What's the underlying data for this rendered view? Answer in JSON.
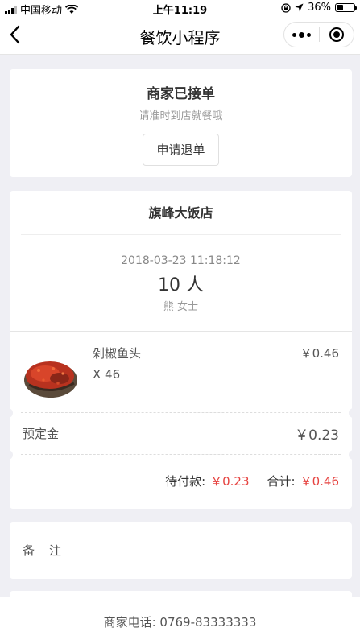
{
  "status_bar": {
    "carrier": "中国移动",
    "time": "上午11:19",
    "battery_percent": "36%",
    "battery_level": 0.36
  },
  "nav": {
    "title": "餐饮小程序"
  },
  "order_status": {
    "title": "商家已接单",
    "subtitle": "请准时到店就餐哦",
    "refund_label": "申请退单"
  },
  "order": {
    "store_name": "旗峰大饭店",
    "time": "2018-03-23 11:18:12",
    "people": "10 人",
    "customer": "熊 女士",
    "items": [
      {
        "name": "剁椒鱼头",
        "qty": "X 46",
        "price": "￥0.46"
      }
    ],
    "deposit_label": "预定金",
    "deposit_value": "￥0.23",
    "to_pay_label": "待付款:",
    "to_pay_value": "￥0.23",
    "total_label": "合计:",
    "total_value": "￥0.46"
  },
  "remarks": {
    "label": "备注"
  },
  "footer": {
    "phone_text": "商家电话: 0769-83333333"
  }
}
